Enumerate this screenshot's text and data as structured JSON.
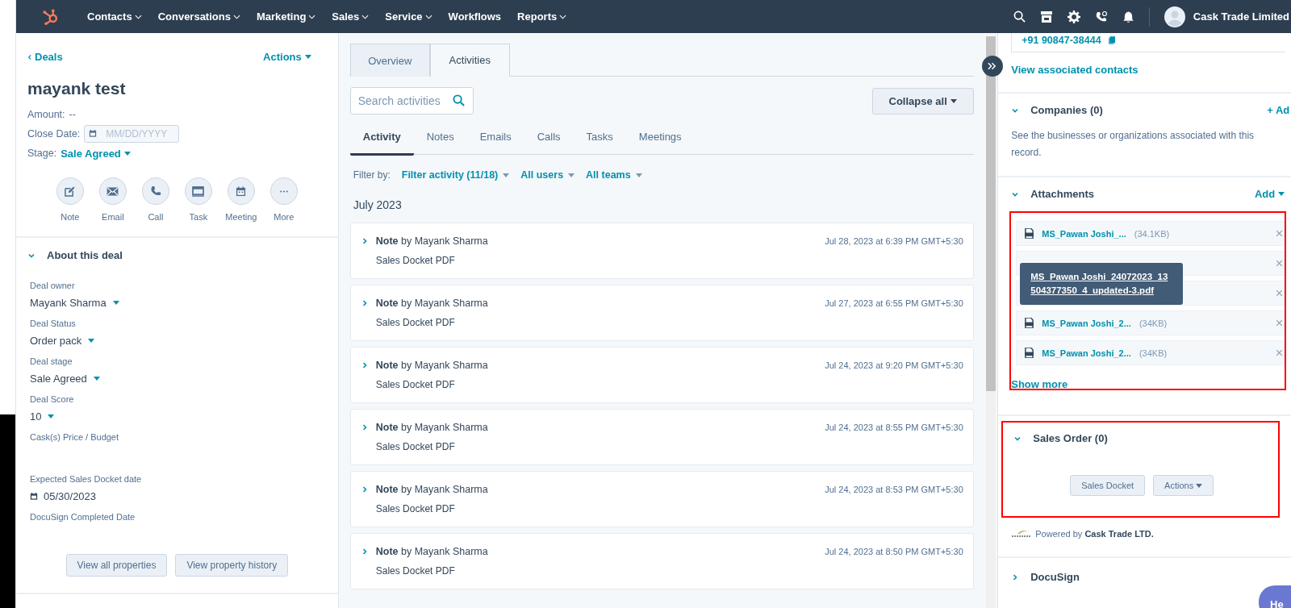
{
  "nav": {
    "items": [
      {
        "label": "Contacts",
        "menu": true
      },
      {
        "label": "Conversations",
        "menu": true
      },
      {
        "label": "Marketing",
        "menu": true
      },
      {
        "label": "Sales",
        "menu": true
      },
      {
        "label": "Service",
        "menu": true
      },
      {
        "label": "Workflows",
        "menu": false
      },
      {
        "label": "Reports",
        "menu": true
      }
    ],
    "account": "Cask Trade Limited"
  },
  "left": {
    "back": "Deals",
    "actions": "Actions",
    "title": "mayank test",
    "amount_label": "Amount:",
    "amount": "--",
    "close_date_label": "Close Date:",
    "close_date_placeholder": "MM/DD/YYYY",
    "stage_label": "Stage:",
    "stage": "Sale Agreed",
    "quick_actions": [
      {
        "kind": "note",
        "label": "Note"
      },
      {
        "kind": "email",
        "label": "Email"
      },
      {
        "kind": "call",
        "label": "Call"
      },
      {
        "kind": "task",
        "label": "Task"
      },
      {
        "kind": "meeting",
        "label": "Meeting"
      },
      {
        "kind": "more",
        "label": "More"
      }
    ],
    "about": {
      "title": "About this deal",
      "expanded": true,
      "properties": [
        {
          "label": "Deal owner",
          "kind": "dropdown",
          "value": "Mayank Sharma"
        },
        {
          "label": "Deal Status",
          "kind": "dropdown",
          "value": "Order pack"
        },
        {
          "label": "Deal stage",
          "kind": "dropdown",
          "value": "Sale Agreed"
        },
        {
          "label": "Deal Score",
          "kind": "dropdown",
          "value": "10"
        },
        {
          "label": "Cask(s) Price / Budget",
          "kind": "empty"
        },
        {
          "label": "Expected Sales Docket date",
          "kind": "date",
          "value": "05/30/2023"
        },
        {
          "label": "DocuSign Completed Date",
          "kind": "empty"
        }
      ]
    },
    "buttons": [
      "View all properties",
      "View property history"
    ]
  },
  "middle": {
    "tabs": [
      {
        "label": "Overview",
        "selected": false
      },
      {
        "label": "Activities",
        "selected": true
      }
    ],
    "search_placeholder": "Search activities",
    "collapse": "Collapse all",
    "subtabs": [
      {
        "label": "Activity",
        "selected": true
      },
      {
        "label": "Notes",
        "selected": false
      },
      {
        "label": "Emails",
        "selected": false
      },
      {
        "label": "Calls",
        "selected": false
      },
      {
        "label": "Tasks",
        "selected": false
      },
      {
        "label": "Meetings",
        "selected": false
      }
    ],
    "filter": {
      "label": "Filter by:",
      "options": [
        "Filter activity (11/18)",
        "All users",
        "All teams"
      ]
    },
    "month": "July 2023",
    "activities": [
      {
        "title": "**Note** by Mayank Sharma",
        "date": "Jul 28, 2023 at 6:39 PM GMT+5:30",
        "body": "Sales Docket PDF"
      },
      {
        "title": "**Note** by Mayank Sharma",
        "date": "Jul 27, 2023 at 6:55 PM GMT+5:30",
        "body": "Sales Docket PDF"
      },
      {
        "title": "**Note** by Mayank Sharma",
        "date": "Jul 24, 2023 at 9:20 PM GMT+5:30",
        "body": "Sales Docket PDF"
      },
      {
        "title": "**Note** by Mayank Sharma",
        "date": "Jul 24, 2023 at 8:55 PM GMT+5:30",
        "body": "Sales Docket PDF"
      },
      {
        "title": "**Note** by Mayank Sharma",
        "date": "Jul 24, 2023 at 8:53 PM GMT+5:30",
        "body": "Sales Docket PDF"
      },
      {
        "title": "**Note** by Mayank Sharma",
        "date": "Jul 24, 2023 at 8:50 PM GMT+5:30",
        "body": "Sales Docket PDF"
      }
    ]
  },
  "right": {
    "phone": "+91 90847-38444",
    "view_contacts": "View associated contacts",
    "companies": {
      "title": "Companies (0)",
      "expanded": true,
      "add": "+ Ad",
      "description": "See the businesses or organizations associated with this record."
    },
    "attachments": {
      "title": "Attachments",
      "expanded": true,
      "add": "Add",
      "items": [
        {
          "kind": "file",
          "name": "MS_Pawan Joshi_...",
          "size": "(34.1KB)"
        },
        {
          "kind": "covered"
        },
        {
          "kind": "covered"
        },
        {
          "kind": "file",
          "name": "MS_Pawan Joshi_2...",
          "size": "(34KB)"
        },
        {
          "kind": "file",
          "name": "MS_Pawan Joshi_2...",
          "size": "(34KB)"
        }
      ],
      "tooltip": "MS_Pawan Joshi_24072023_13504377350_4_updated-3.pdf",
      "show_more": "Show more"
    },
    "sales_order": {
      "title": "Sales Order (0)",
      "expanded": true,
      "buttons": [
        {
          "label": "Sales Docket",
          "menu": false
        },
        {
          "label": "Actions",
          "menu": true
        }
      ]
    },
    "powered": "Powered by **Cask Trade LTD.**",
    "docusign": {
      "title": "DocuSign",
      "expanded": false
    },
    "chat": "He"
  }
}
